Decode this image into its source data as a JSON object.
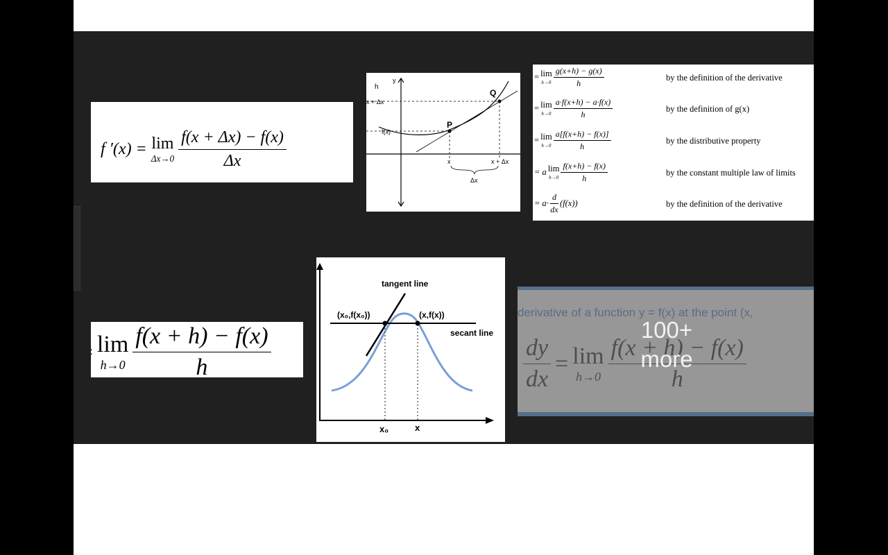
{
  "gallery": {
    "thumb1": {
      "lhs": "f ′(x) =",
      "lim": "lim",
      "lim_sub": "Δx→0",
      "num": "f(x + Δx) − f(x)",
      "den": "Δx"
    },
    "thumb2": {
      "labels": {
        "y": "y",
        "h": "h",
        "x_dx": "x + Δx",
        "fx": "f(x)",
        "P": "P",
        "Q": "Q",
        "x": "x",
        "x_plus_dx": "x + Δx",
        "dx": "Δx"
      }
    },
    "thumb3": {
      "rows": [
        {
          "prefix": "=",
          "lim": "lim",
          "sub": "h→0",
          "num": "g(x+h) − g(x)",
          "den": "h",
          "reason": "by the definition of the derivative"
        },
        {
          "prefix": "=",
          "lim": "lim",
          "sub": "h→0",
          "num": "a·f(x+h) − a·f(x)",
          "den": "h",
          "reason": "by the definition of g(x)"
        },
        {
          "prefix": "=",
          "lim": "lim",
          "sub": "h→0",
          "num": "a[f(x+h) − f(x)]",
          "den": "h",
          "reason": "by the distributive property"
        },
        {
          "prefix": "= a",
          "lim": "lim",
          "sub": "h→0",
          "num": "f(x+h) − f(x)",
          "den": "h",
          "reason": "by the constant multiple law of limits"
        },
        {
          "prefix": "= a·",
          "lim": "",
          "sub": "",
          "num": "d",
          "den": "dx",
          "suffix": "(f(x))",
          "reason": "by the definition of the derivative"
        }
      ]
    },
    "thumb4": {
      "lhs": "=",
      "lim": "lim",
      "lim_sub": "h→0",
      "num": "f(x + h) − f(x)",
      "den": "h"
    },
    "thumb5": {
      "tangent_label": "tangent line",
      "secant_label": "secant line",
      "point1": "(x₀,f(x₀))",
      "point2": "(x,f(x))",
      "x0": "x₀",
      "x": "x",
      "curve_color": "#7a9fd6"
    },
    "thumb6": {
      "caption": "derivative of a function y = f(x) at the point (x,",
      "lhs_num": "dy",
      "lhs_den": "dx",
      "equals": "=",
      "lim": "lim",
      "lim_sub": "h→0",
      "num": "f(x + h) − f(x)",
      "den": "h",
      "more_count": "100+",
      "more_label": "more",
      "accent": "#3f6fa0"
    }
  }
}
